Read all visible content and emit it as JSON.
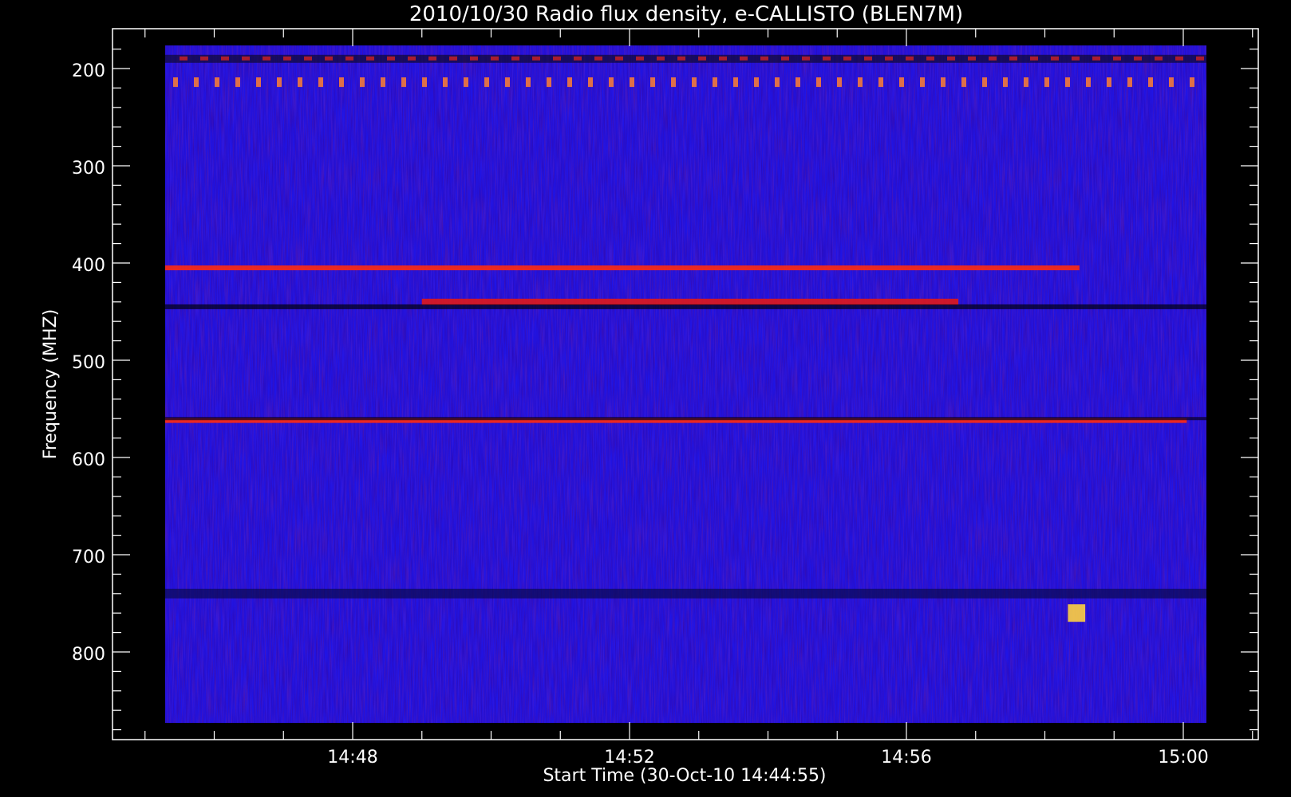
{
  "chart_data": {
    "type": "heatmap",
    "title": "2010/10/30  Radio flux density, e-CALLISTO (BLEN7M)",
    "xlabel": "Start Time (30-Oct-10 14:44:55)",
    "ylabel": "Frequency (MHZ)",
    "x_ticks": [
      "14:48",
      "14:52",
      "14:56",
      "15:00"
    ],
    "y_ticks": [
      "200",
      "300",
      "400",
      "500",
      "600",
      "700",
      "800"
    ],
    "x_range": [
      "14:44:55",
      "15:00:03"
    ],
    "y_range": [
      180,
      875
    ],
    "y_inverted": true,
    "colormap": [
      "#000000",
      "#1a0ab0",
      "#2020ff",
      "#6010c0",
      "#c01020",
      "#ff2000",
      "#ff8000",
      "#ffff80"
    ],
    "features": [
      {
        "label": "persistent emission line",
        "freq_mhz": 405,
        "start": "14:44:55",
        "end": "14:58:30"
      },
      {
        "label": "intermittent emission",
        "freq_mhz": 440,
        "start": "14:49:00",
        "end": "14:56:45"
      },
      {
        "label": "persistent emission line",
        "freq_mhz": 562,
        "start": "14:44:55",
        "end": "15:00:03"
      },
      {
        "label": "burst",
        "freq_mhz": 760,
        "start": "14:58:20",
        "end": "14:58:35"
      }
    ]
  }
}
